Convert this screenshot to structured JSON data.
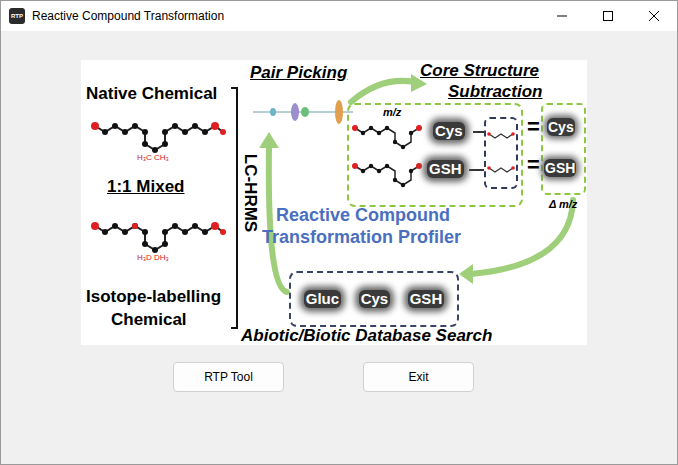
{
  "window": {
    "title": "Reactive Compound Transformation",
    "icon": "RTP"
  },
  "figure": {
    "native_label": "Native Chemical",
    "native_substituent": "H₃C CH₃",
    "mixed_label": "1:1 Mixed",
    "labelled_substituent": "H₃D DH₃",
    "isotope_label": [
      "Isotope-labelling",
      "Chemical"
    ],
    "method": "LC-HRMS",
    "pair_picking": "Pair Picking",
    "core_title": [
      "Core Structure",
      "Subtraction"
    ],
    "axis_label": "m/z",
    "core_labels": [
      "Cys",
      "GSH"
    ],
    "equals": [
      "=",
      "="
    ],
    "delta_labels": [
      "Cys",
      "GSH"
    ],
    "delta_caption": "Δ m/z",
    "profiler_title": [
      "Reactive Compound",
      "Transformation Profiler"
    ],
    "database_labels": [
      "Gluc",
      "Cys",
      "GSH"
    ],
    "database_caption": "Abiotic/Biotic Database Search"
  },
  "buttons": [
    {
      "label": "RTP Tool"
    },
    {
      "label": "Exit"
    }
  ]
}
